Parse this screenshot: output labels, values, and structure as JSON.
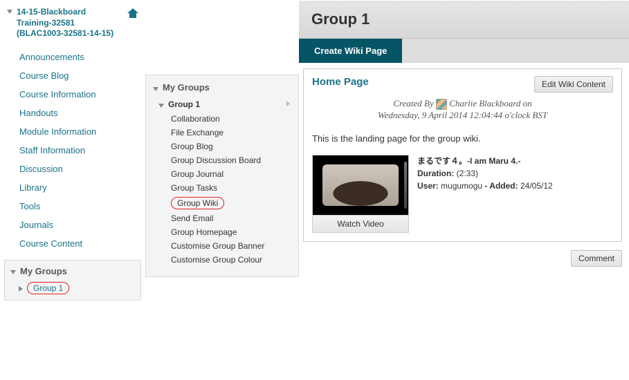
{
  "course": {
    "title": "14-15-Blackboard Training-32581 (BLAC1003-32581-14-15)"
  },
  "nav": {
    "items": [
      "Announcements",
      "Course Blog",
      "Course Information",
      "Handouts",
      "Module Information",
      "Staff Information",
      "Discussion",
      "Library",
      "Tools",
      "Journals",
      "Course Content"
    ]
  },
  "left_groups": {
    "heading": "My Groups",
    "group_name": "Group 1"
  },
  "mid": {
    "heading": "My Groups",
    "group_name": "Group 1",
    "tools": [
      "Collaboration",
      "File Exchange",
      "Group Blog",
      "Group Discussion Board",
      "Group Journal",
      "Group Tasks",
      "Group Wiki",
      "Send Email",
      "Group Homepage",
      "Customise Group Banner",
      "Customise Group Colour"
    ]
  },
  "right": {
    "page_heading": "Group 1",
    "tab_label": "Create Wiki Page",
    "wiki_title": "Home Page",
    "edit_btn": "Edit Wiki Content",
    "created_prefix": "Created By",
    "author": "Charlie Blackboard",
    "created_suffix": "on",
    "created_line2": "Wednesday, 9 April 2014 12:04:44 o'clock BST",
    "landing": "This is the landing page for the group wiki.",
    "video": {
      "watch": "Watch Video",
      "title": "まるです４。-I am Maru 4.-",
      "duration_label": "Duration:",
      "duration": "(2:33)",
      "user_label": "User:",
      "user": "mugumogu",
      "added_label": "- Added:",
      "added": "24/05/12"
    },
    "comment_btn": "Comment"
  }
}
